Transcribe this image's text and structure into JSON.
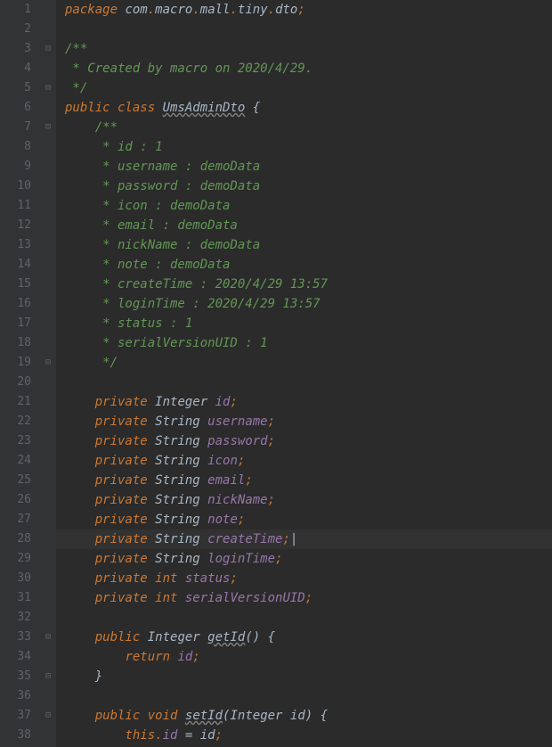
{
  "lines": [
    {
      "n": 1,
      "fold": "",
      "tokens": [
        [
          "kw",
          "package "
        ],
        [
          "ident",
          "com"
        ],
        [
          "punct",
          "."
        ],
        [
          "ident",
          "macro"
        ],
        [
          "punct",
          "."
        ],
        [
          "ident",
          "mall"
        ],
        [
          "punct",
          "."
        ],
        [
          "ident",
          "tiny"
        ],
        [
          "punct",
          "."
        ],
        [
          "ident",
          "dto"
        ],
        [
          "punct",
          ";"
        ]
      ]
    },
    {
      "n": 2,
      "fold": "",
      "tokens": []
    },
    {
      "n": 3,
      "fold": "open",
      "tokens": [
        [
          "comment",
          "/**"
        ]
      ]
    },
    {
      "n": 4,
      "fold": "",
      "tokens": [
        [
          "comment",
          " * Created by macro on 2020/4/29."
        ]
      ]
    },
    {
      "n": 5,
      "fold": "close",
      "tokens": [
        [
          "comment",
          " */"
        ]
      ]
    },
    {
      "n": 6,
      "fold": "",
      "tokens": [
        [
          "kw",
          "public class "
        ],
        [
          "underline",
          "UmsAdminDto"
        ],
        [
          "brace",
          " {"
        ]
      ]
    },
    {
      "n": 7,
      "fold": "open",
      "indent": 1,
      "tokens": [
        [
          "comment",
          "/**"
        ]
      ]
    },
    {
      "n": 8,
      "fold": "",
      "indent": 1,
      "tokens": [
        [
          "comment",
          " * id : 1"
        ]
      ]
    },
    {
      "n": 9,
      "fold": "",
      "indent": 1,
      "tokens": [
        [
          "comment",
          " * username : demoData"
        ]
      ]
    },
    {
      "n": 10,
      "fold": "",
      "indent": 1,
      "tokens": [
        [
          "comment",
          " * password : demoData"
        ]
      ]
    },
    {
      "n": 11,
      "fold": "",
      "indent": 1,
      "tokens": [
        [
          "comment",
          " * icon : demoData"
        ]
      ]
    },
    {
      "n": 12,
      "fold": "",
      "indent": 1,
      "tokens": [
        [
          "comment",
          " * email : demoData"
        ]
      ]
    },
    {
      "n": 13,
      "fold": "",
      "indent": 1,
      "tokens": [
        [
          "comment",
          " * nickName : demoData"
        ]
      ]
    },
    {
      "n": 14,
      "fold": "",
      "indent": 1,
      "tokens": [
        [
          "comment",
          " * note : demoData"
        ]
      ]
    },
    {
      "n": 15,
      "fold": "",
      "indent": 1,
      "tokens": [
        [
          "comment",
          " * createTime : 2020/4/29 13:57"
        ]
      ]
    },
    {
      "n": 16,
      "fold": "",
      "indent": 1,
      "tokens": [
        [
          "comment",
          " * loginTime : 2020/4/29 13:57"
        ]
      ]
    },
    {
      "n": 17,
      "fold": "",
      "indent": 1,
      "tokens": [
        [
          "comment",
          " * status : 1"
        ]
      ]
    },
    {
      "n": 18,
      "fold": "",
      "indent": 1,
      "tokens": [
        [
          "comment",
          " * serialVersionUID : 1"
        ]
      ]
    },
    {
      "n": 19,
      "fold": "close",
      "indent": 1,
      "tokens": [
        [
          "comment",
          " */"
        ]
      ]
    },
    {
      "n": 20,
      "fold": "",
      "tokens": []
    },
    {
      "n": 21,
      "fold": "",
      "indent": 1,
      "tokens": [
        [
          "kw",
          "private "
        ],
        [
          "type",
          "Integer "
        ],
        [
          "field",
          "id"
        ],
        [
          "punct",
          ";"
        ]
      ]
    },
    {
      "n": 22,
      "fold": "",
      "indent": 1,
      "tokens": [
        [
          "kw",
          "private "
        ],
        [
          "type",
          "String "
        ],
        [
          "field",
          "username"
        ],
        [
          "punct",
          ";"
        ]
      ]
    },
    {
      "n": 23,
      "fold": "",
      "indent": 1,
      "tokens": [
        [
          "kw",
          "private "
        ],
        [
          "type",
          "String "
        ],
        [
          "field",
          "password"
        ],
        [
          "punct",
          ";"
        ]
      ]
    },
    {
      "n": 24,
      "fold": "",
      "indent": 1,
      "tokens": [
        [
          "kw",
          "private "
        ],
        [
          "type",
          "String "
        ],
        [
          "field",
          "icon"
        ],
        [
          "punct",
          ";"
        ]
      ]
    },
    {
      "n": 25,
      "fold": "",
      "indent": 1,
      "tokens": [
        [
          "kw",
          "private "
        ],
        [
          "type",
          "String "
        ],
        [
          "field",
          "email"
        ],
        [
          "punct",
          ";"
        ]
      ]
    },
    {
      "n": 26,
      "fold": "",
      "indent": 1,
      "tokens": [
        [
          "kw",
          "private "
        ],
        [
          "type",
          "String "
        ],
        [
          "field",
          "nickName"
        ],
        [
          "punct",
          ";"
        ]
      ]
    },
    {
      "n": 27,
      "fold": "",
      "indent": 1,
      "tokens": [
        [
          "kw",
          "private "
        ],
        [
          "type",
          "String "
        ],
        [
          "field",
          "note"
        ],
        [
          "punct",
          ";"
        ]
      ]
    },
    {
      "n": 28,
      "fold": "",
      "indent": 1,
      "active": true,
      "tokens": [
        [
          "kw",
          "private "
        ],
        [
          "type",
          "String "
        ],
        [
          "field",
          "createTime"
        ],
        [
          "punct",
          ";"
        ],
        [
          "caret",
          "|"
        ]
      ]
    },
    {
      "n": 29,
      "fold": "",
      "indent": 1,
      "tokens": [
        [
          "kw",
          "private "
        ],
        [
          "type",
          "String "
        ],
        [
          "field",
          "loginTime"
        ],
        [
          "punct",
          ";"
        ]
      ]
    },
    {
      "n": 30,
      "fold": "",
      "indent": 1,
      "tokens": [
        [
          "kw",
          "private "
        ],
        [
          "kw",
          "int "
        ],
        [
          "field",
          "status"
        ],
        [
          "punct",
          ";"
        ]
      ]
    },
    {
      "n": 31,
      "fold": "",
      "indent": 1,
      "tokens": [
        [
          "kw",
          "private "
        ],
        [
          "kw",
          "int "
        ],
        [
          "field",
          "serialVersionUID"
        ],
        [
          "punct",
          ";"
        ]
      ]
    },
    {
      "n": 32,
      "fold": "",
      "tokens": []
    },
    {
      "n": 33,
      "fold": "open",
      "indent": 1,
      "tokens": [
        [
          "kw",
          "public "
        ],
        [
          "type",
          "Integer "
        ],
        [
          "underline",
          "getId"
        ],
        [
          "paren",
          "() "
        ],
        [
          "brace",
          "{"
        ]
      ]
    },
    {
      "n": 34,
      "fold": "",
      "indent": 2,
      "tokens": [
        [
          "kw",
          "return "
        ],
        [
          "field",
          "id"
        ],
        [
          "punct",
          ";"
        ]
      ]
    },
    {
      "n": 35,
      "fold": "close",
      "indent": 1,
      "tokens": [
        [
          "brace",
          "}"
        ]
      ]
    },
    {
      "n": 36,
      "fold": "",
      "tokens": []
    },
    {
      "n": 37,
      "fold": "open",
      "indent": 1,
      "tokens": [
        [
          "kw",
          "public "
        ],
        [
          "kw",
          "void "
        ],
        [
          "underline",
          "setId"
        ],
        [
          "paren",
          "("
        ],
        [
          "type",
          "Integer "
        ],
        [
          "ident",
          "id"
        ],
        [
          "paren",
          ") "
        ],
        [
          "brace",
          "{"
        ]
      ]
    },
    {
      "n": 38,
      "fold": "",
      "indent": 2,
      "tokens": [
        [
          "kw",
          "this"
        ],
        [
          "punct",
          "."
        ],
        [
          "field",
          "id"
        ],
        [
          "ident",
          " = id"
        ],
        [
          "punct",
          ";"
        ]
      ]
    }
  ],
  "fold_open_glyph": "⊟",
  "fold_close_glyph": "⊟"
}
